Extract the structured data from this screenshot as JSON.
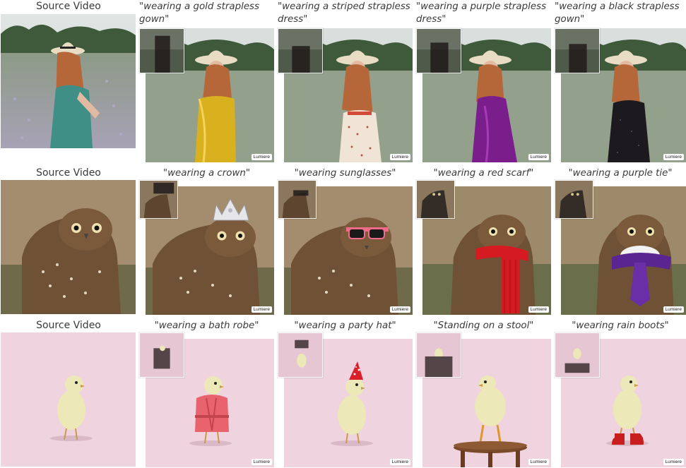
{
  "watermark": "Lumiere",
  "rows": [
    {
      "source_label": "Source Video",
      "prompts": [
        "\"wearing a gold strapless\ngown\"",
        "\"wearing a striped strapless\ndress\"",
        "\"wearing a purple strapless\ndress\"",
        "\"wearing a black strapless\ngown\""
      ]
    },
    {
      "source_label": "Source Video",
      "prompts": [
        "\"wearing a crown\"",
        "\"wearing sunglasses\"",
        "\"wearing a red scarf\"",
        "\"wearing a purple tie\""
      ]
    },
    {
      "source_label": "Source Video",
      "prompts": [
        "\"wearing a bath robe\"",
        "\"wearing a party hat\"",
        "\"Standing on a stool\"",
        "\"wearing rain boots\""
      ]
    }
  ],
  "colors": {
    "gold_gown": "#d9b11e",
    "striped_dress": "#efe4d6",
    "purple_dress": "#7a1e8c",
    "black_gown": "#1c1a1f",
    "crown": "#e6e6ea",
    "sunglasses_frame": "#f06a8a",
    "red_scarf": "#d61a22",
    "purple_tie": "#5a2590",
    "bath_robe": "#e8636c",
    "party_hat": "#d81f2a",
    "stool": "#7a4a2a",
    "rain_boots": "#c81e1e"
  }
}
